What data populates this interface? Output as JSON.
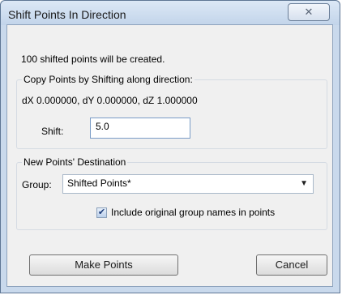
{
  "window": {
    "title": "Shift Points In Direction",
    "close_glyph": "✕"
  },
  "info_text": "100 shifted points will be created.",
  "copy_group": {
    "legend": "Copy Points by Shifting along direction:",
    "direction_text": "dX 0.000000, dY 0.000000, dZ 1.000000",
    "shift_label": "Shift:",
    "shift_value": "5.0"
  },
  "dest_group": {
    "legend": "New Points' Destination",
    "group_label": "Group:",
    "group_value": "Shifted Points*",
    "dropdown_arrow": "▼",
    "include_names_label": "Include original group names in points",
    "include_names_checked": true,
    "check_glyph": "✔"
  },
  "buttons": {
    "make_points": "Make Points",
    "cancel": "Cancel"
  },
  "icons": {
    "close": "close-icon",
    "dropdown": "chevron-down-icon",
    "checkbox": "check-icon"
  }
}
